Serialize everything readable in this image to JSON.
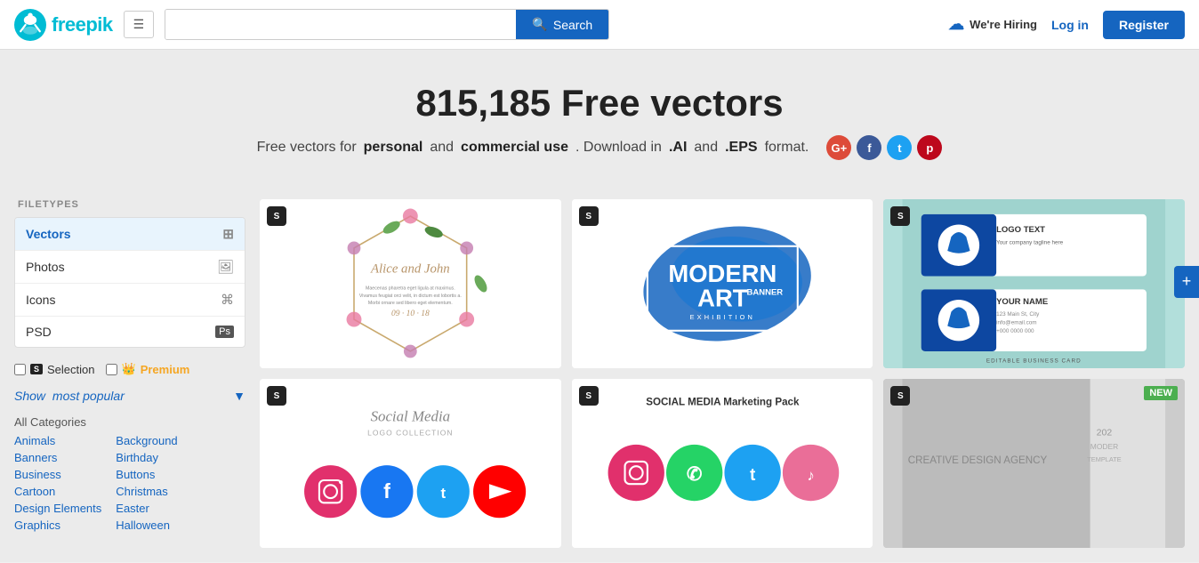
{
  "header": {
    "logo_alt": "freepik",
    "hamburger_label": "☰",
    "search_placeholder": "",
    "search_btn_label": "Search",
    "hiring_label": "We're Hiring",
    "login_label": "Log in",
    "register_label": "Register"
  },
  "hero": {
    "title": "815,185 Free vectors",
    "subtitle_start": "Free vectors for",
    "bold1": "personal",
    "mid": "and",
    "bold2": "commercial use",
    "subtitle_end": ". Download in",
    "bold3": ".AI",
    "and_text": "and",
    "bold4": ".EPS",
    "format_text": "format."
  },
  "sidebar": {
    "filetypes_title": "FILETYPES",
    "filetypes": [
      {
        "label": "Vectors",
        "active": true
      },
      {
        "label": "Photos",
        "active": false
      },
      {
        "label": "Icons",
        "active": false
      },
      {
        "label": "PSD",
        "active": false
      }
    ],
    "selection_label": "Selection",
    "premium_label": "Premium",
    "show_popular_label": "Show",
    "most_popular_label": "most popular",
    "categories": {
      "all_label": "All Categories",
      "col1": [
        "Animals",
        "Banners",
        "Business",
        "Cartoon",
        "Design Elements",
        "Graphics"
      ],
      "col2": [
        "Background",
        "Birthday",
        "Buttons",
        "Christmas",
        "Easter",
        "Halloween"
      ]
    }
  },
  "grid": {
    "items": [
      {
        "type": "floral",
        "badge": "S",
        "description": "Floral wedding invitation"
      },
      {
        "type": "art",
        "badge": "S",
        "description": "Modern Art Banner Exhibition"
      },
      {
        "type": "business",
        "badge": "S",
        "description": "Editable Business Card"
      },
      {
        "type": "social",
        "badge": "S",
        "description": "Social Media Logo Collection"
      },
      {
        "type": "pack",
        "badge": "S",
        "description": "Social Media Marketing Pack"
      },
      {
        "type": "new",
        "badge": "S",
        "description": "Creative Design Agency Template",
        "new": true
      }
    ]
  },
  "expand_btn_label": "+"
}
